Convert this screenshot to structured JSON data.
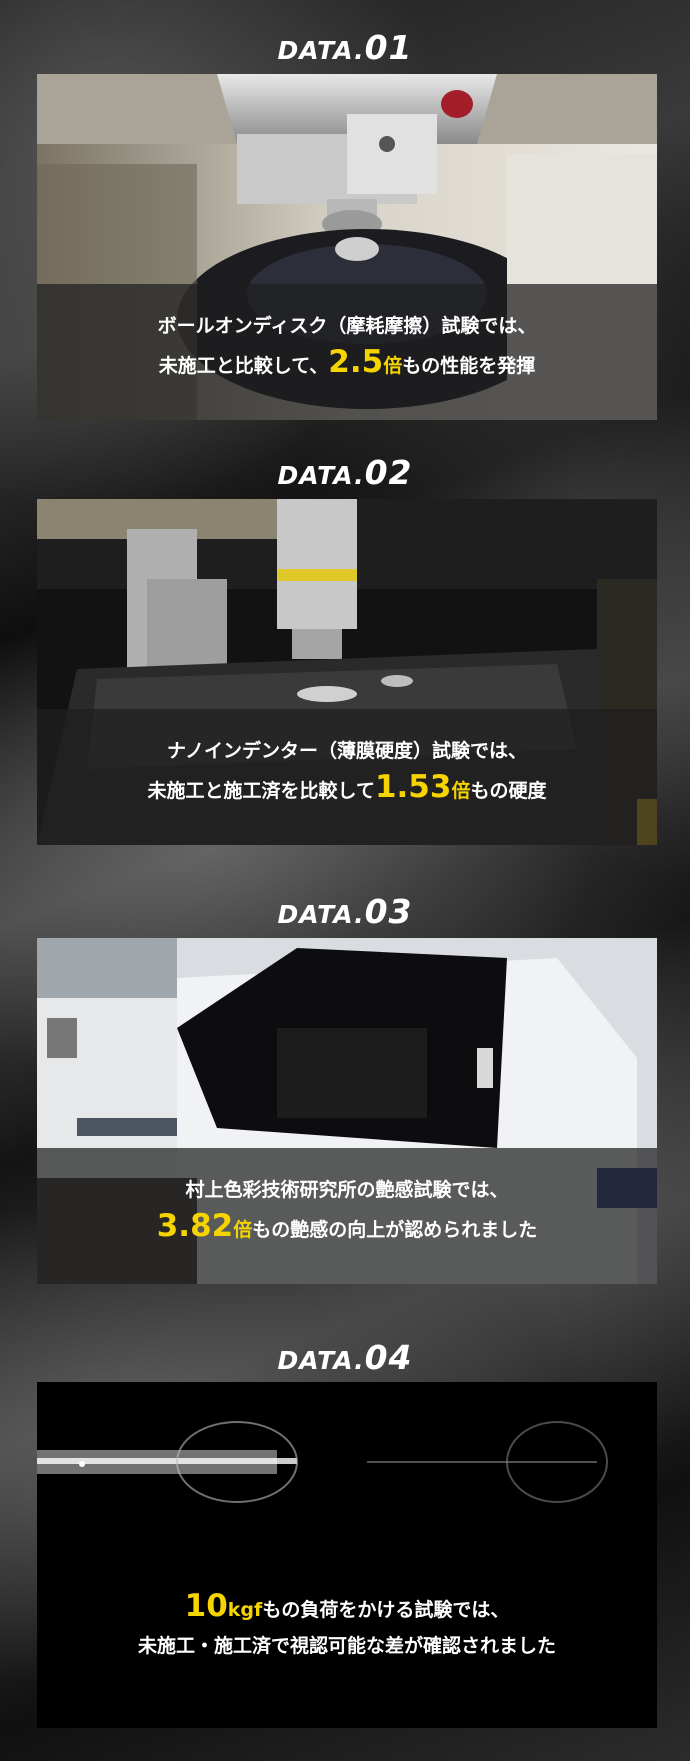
{
  "accent_color": "#f5d400",
  "sections": [
    {
      "heading_prefix": "DATA.",
      "heading_number": "01",
      "caption_line1": "ボールオンディスク（摩耗摩擦）試験では、",
      "caption_line2_before": "未施工と比較して、",
      "highlight_value": "2.5",
      "highlight_unit": "倍",
      "caption_line2_after": "もの性能を発揮"
    },
    {
      "heading_prefix": "DATA.",
      "heading_number": "02",
      "caption_line1": "ナノインデンター（薄膜硬度）試験では、",
      "caption_line2_before": "未施工と施工済を比較して",
      "highlight_value": "1.53",
      "highlight_unit": "倍",
      "caption_line2_after": "もの硬度"
    },
    {
      "heading_prefix": "DATA.",
      "heading_number": "03",
      "caption_line1": "村上色彩技術研究所の艶感試験では、",
      "caption_line2_before": "",
      "highlight_value": "3.82",
      "highlight_unit": "倍",
      "caption_line2_after": "もの艶感の向上が認められました"
    },
    {
      "heading_prefix": "DATA.",
      "heading_number": "04",
      "highlight_value": "10",
      "highlight_unit": "kgf",
      "caption_line1_after": "もの負荷をかける試験では、",
      "caption_line2": "未施工・施工済で視認可能な差が確認されました"
    }
  ]
}
